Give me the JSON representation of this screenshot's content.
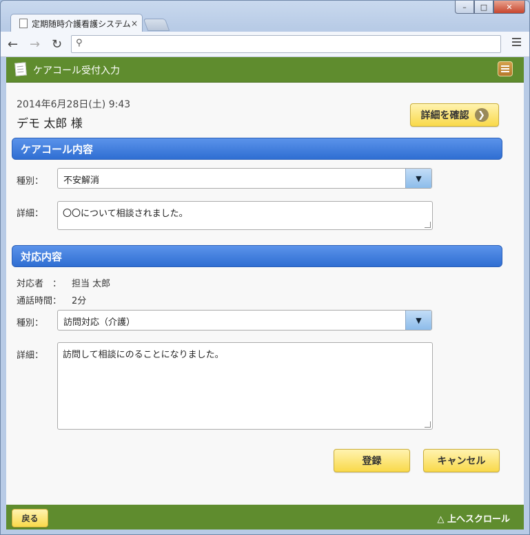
{
  "browser": {
    "tab_title": "定期随時介護看護システム",
    "tab_close": "×",
    "omnibox_value": ""
  },
  "window": {
    "min": "–",
    "max": "□",
    "close": "✕"
  },
  "header": {
    "title": "ケアコール受付入力",
    "menu_icon": "menu-icon"
  },
  "record": {
    "datetime": "2014年6月28日(土) 9:43",
    "patient": "デモ 太郎 様",
    "detail_button": "詳細を確認"
  },
  "care_call": {
    "section_title": "ケアコール内容",
    "type_label": "種別：",
    "type_value": "不安解消",
    "detail_label": "詳細：",
    "detail_value": "〇〇について相談されました。"
  },
  "response": {
    "section_title": "対応内容",
    "responder_label": "対応者　：",
    "responder_value": "担当 太郎",
    "duration_label": "通話時間：",
    "duration_value": "2分",
    "type_label": "種別：",
    "type_value": "訪問対応（介護）",
    "detail_label": "詳細：",
    "detail_value": "訪問して相談にのることになりました。"
  },
  "actions": {
    "register": "登録",
    "cancel": "キャンセル"
  },
  "footer": {
    "back": "戻る",
    "scroll_top": "△ 上へスクロール"
  }
}
